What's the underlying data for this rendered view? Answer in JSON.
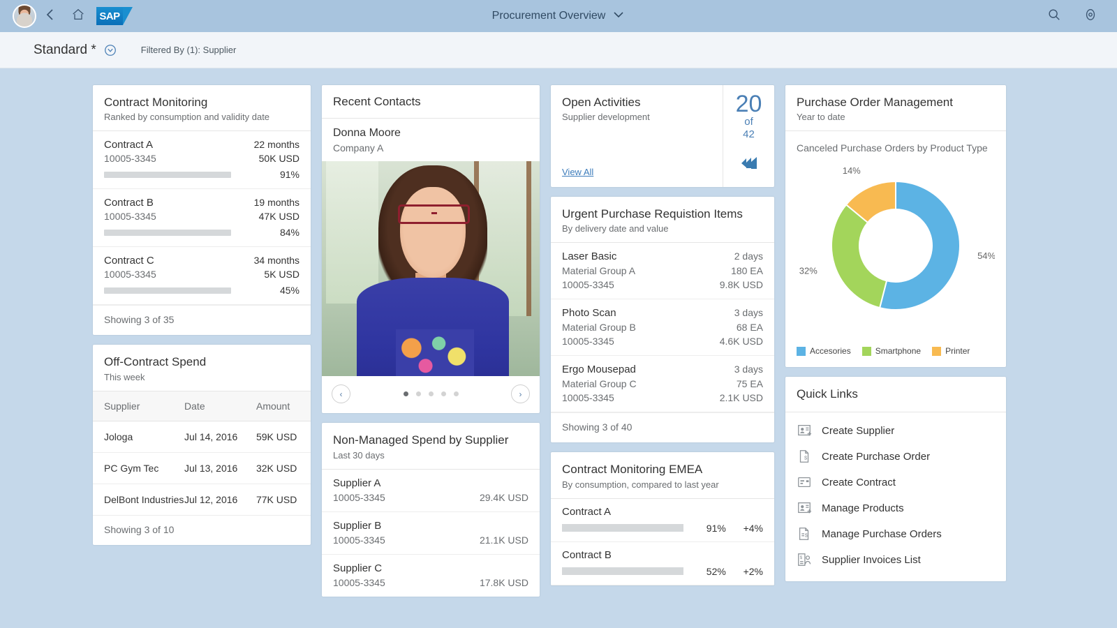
{
  "shell": {
    "title": "Procurement Overview",
    "icons": {
      "back": "back-arrow-icon",
      "home": "home-icon",
      "logo": "SAP",
      "search": "search-icon",
      "assistant": "assistant-icon"
    }
  },
  "filter_bar": {
    "variant": "Standard *",
    "filtered_by": "Filtered By (1): Supplier"
  },
  "contract_monitoring": {
    "title": "Contract Monitoring",
    "subtitle": "Ranked by consumption and validity date",
    "items": [
      {
        "name": "Contract A",
        "id": "10005-3345",
        "duration": "22 months",
        "amount": "50K USD",
        "percent": "91%",
        "value": 91,
        "color": "#bb0000"
      },
      {
        "name": "Contract B",
        "id": "10005-3345",
        "duration": "19 months",
        "amount": "47K USD",
        "percent": "84%",
        "value": 84,
        "color": "#e9a020"
      },
      {
        "name": "Contract C",
        "id": "10005-3345",
        "duration": "34 months",
        "amount": "5K USD",
        "percent": "45%",
        "value": 45,
        "color": "#2eaa5b"
      }
    ],
    "footer": "Showing 3 of 35"
  },
  "off_contract_spend": {
    "title": "Off-Contract Spend",
    "subtitle": "This week",
    "columns": [
      "Supplier",
      "Date",
      "Amount"
    ],
    "rows": [
      {
        "supplier": "Jologa",
        "date": "Jul 14, 2016",
        "amount": "59K USD"
      },
      {
        "supplier": "PC Gym Tec",
        "date": "Jul 13, 2016",
        "amount": "32K USD"
      },
      {
        "supplier": "DelBont Industries",
        "date": "Jul 12, 2016",
        "amount": "77K USD"
      }
    ],
    "footer": "Showing 3 of 10"
  },
  "recent_contacts": {
    "title": "Recent Contacts",
    "contact_name": "Donna Moore",
    "contact_company": "Company A",
    "carousel": {
      "prev": "‹",
      "next": "›",
      "dots": 5,
      "active_dot": 0
    }
  },
  "non_managed_spend": {
    "title": "Non-Managed Spend by Supplier",
    "subtitle": "Last 30 days",
    "items": [
      {
        "name": "Supplier A",
        "id": "10005-3345",
        "amount": "29.4K USD"
      },
      {
        "name": "Supplier B",
        "id": "10005-3345",
        "amount": "21.1K USD"
      },
      {
        "name": "Supplier C",
        "id": "10005-3345",
        "amount": "17.8K USD"
      }
    ]
  },
  "open_activities": {
    "title": "Open Activities",
    "subtitle": "Supplier development",
    "view_all": "View All",
    "kpi_value": "20",
    "kpi_of": "of",
    "kpi_total": "42",
    "icon": "activity-items-icon"
  },
  "urgent_requisitions": {
    "title": "Urgent Purchase Requistion Items",
    "subtitle": "By delivery date and value",
    "items": [
      {
        "name": "Laser Basic",
        "group": "Material Group A",
        "id": "10005-3345",
        "days": "2 days",
        "qty": "180 EA",
        "amount": "9.8K USD"
      },
      {
        "name": "Photo Scan",
        "group": "Material Group B",
        "id": "10005-3345",
        "days": "3 days",
        "qty": "68 EA",
        "amount": "4.6K USD"
      },
      {
        "name": "Ergo Mousepad",
        "group": "Material Group C",
        "id": "10005-3345",
        "days": "3 days",
        "qty": "75 EA",
        "amount": "2.1K USD"
      }
    ],
    "footer": "Showing 3 of 40"
  },
  "contract_monitoring_emea": {
    "title": "Contract Monitoring EMEA",
    "subtitle": "By consumption, compared to last year",
    "items": [
      {
        "name": "Contract A",
        "percent": "91%",
        "value": 91,
        "delta": "+4%"
      },
      {
        "name": "Contract B",
        "percent": "52%",
        "value": 52,
        "delta": "+2%"
      }
    ]
  },
  "purchase_order_management": {
    "title": "Purchase Order Management",
    "subtitle": "Year to date"
  },
  "quick_links": {
    "title": "Quick Links",
    "items": [
      {
        "label": "Create Supplier",
        "icon": "add-contact-icon"
      },
      {
        "label": "Create Purchase Order",
        "icon": "document-dollar-icon"
      },
      {
        "label": "Create Contract",
        "icon": "card-icon"
      },
      {
        "label": "Manage Products",
        "icon": "add-contact-icon"
      },
      {
        "label": "Manage Purchase Orders",
        "icon": "list-dollar-icon"
      },
      {
        "label": "Supplier Invoices List",
        "icon": "invoice-person-icon"
      }
    ]
  },
  "chart_data": {
    "type": "pie",
    "title": "Canceled Purchase Orders by Product Type",
    "labels": [
      "Accesories",
      "Smartphone",
      "Printer"
    ],
    "values": [
      54,
      32,
      14
    ],
    "value_labels": [
      "54%",
      "32%",
      "14%"
    ],
    "colors": [
      "#5cb3e4",
      "#a3d55b",
      "#f8ba51"
    ],
    "donut": true,
    "legend_position": "bottom",
    "xlabel": "",
    "ylabel": ""
  }
}
